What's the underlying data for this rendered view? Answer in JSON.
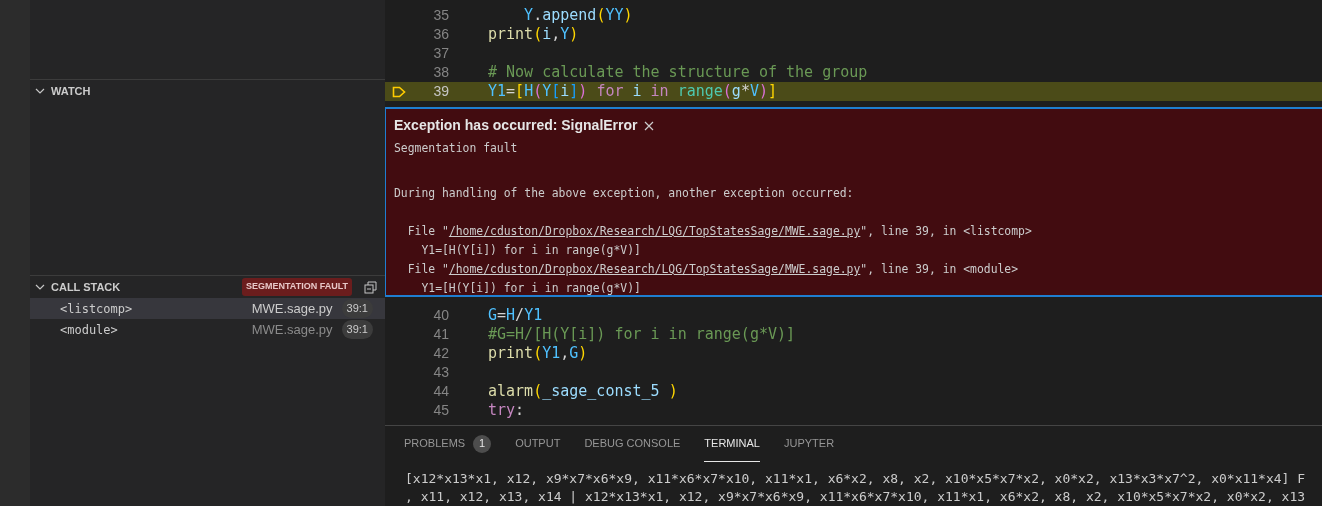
{
  "sidebar": {
    "sections": [
      {
        "title": "WATCH",
        "expanded": true
      },
      {
        "title": "CALL STACK",
        "expanded": true,
        "badge": "SEGMENTATION FAULT",
        "frames": [
          {
            "name": "<listcomp>",
            "file": "MWE.sage.py",
            "position": "39:1",
            "selected": true
          },
          {
            "name": "<module>",
            "file": "MWE.sage.py",
            "position": "39:1",
            "selected": false
          }
        ]
      }
    ]
  },
  "editor": {
    "lines_before": [
      {
        "number": "35",
        "current": false,
        "tokens": [
          {
            "text": "    Y",
            "kind": "const"
          },
          {
            "text": ".",
            "kind": "plain"
          },
          {
            "text": "append",
            "kind": "var"
          },
          {
            "text": "(",
            "kind": "b1"
          },
          {
            "text": "YY",
            "kind": "const"
          },
          {
            "text": ")",
            "kind": "b1"
          }
        ]
      },
      {
        "number": "36",
        "current": false,
        "tokens": [
          {
            "text": "print",
            "kind": "func"
          },
          {
            "text": "(",
            "kind": "b1"
          },
          {
            "text": "i",
            "kind": "var"
          },
          {
            "text": ",",
            "kind": "plain"
          },
          {
            "text": "Y",
            "kind": "const"
          },
          {
            "text": ")",
            "kind": "b1"
          }
        ]
      },
      {
        "number": "37",
        "current": false
      },
      {
        "number": "38",
        "current": false,
        "tokens": [
          {
            "text": "# Now calculate the structure of the group",
            "kind": "comment"
          }
        ]
      },
      {
        "number": "39",
        "current": true,
        "tokens": [
          {
            "text": "Y1",
            "kind": "const"
          },
          {
            "text": "=",
            "kind": "plain"
          },
          {
            "text": "[",
            "kind": "b1"
          },
          {
            "text": "H",
            "kind": "const"
          },
          {
            "text": "(",
            "kind": "b2"
          },
          {
            "text": "Y",
            "kind": "const"
          },
          {
            "text": "[",
            "kind": "b3"
          },
          {
            "text": "i",
            "kind": "var"
          },
          {
            "text": "]",
            "kind": "b3"
          },
          {
            "text": ") ",
            "kind": "b2"
          },
          {
            "text": "for",
            "kind": "kw"
          },
          {
            "text": " i ",
            "kind": "var"
          },
          {
            "text": "in ",
            "kind": "kw"
          },
          {
            "text": "range",
            "kind": "builtin"
          },
          {
            "text": "(",
            "kind": "b2"
          },
          {
            "text": "g",
            "kind": "var"
          },
          {
            "text": "*",
            "kind": "plain"
          },
          {
            "text": "V",
            "kind": "const"
          },
          {
            "text": ")",
            "kind": "b2"
          },
          {
            "text": "]",
            "kind": "b1"
          }
        ]
      }
    ],
    "exception": {
      "title": "Exception has occurred: SignalError",
      "message": "Segmentation fault",
      "note": "During handling of the above exception, another exception occurred:",
      "frames": [
        {
          "prefix": "  File \"",
          "path": "/home/cduston/Dropbox/Research/LQG/TopStatesSage/MWE.sage.py",
          "suffix": "\", line 39, in <listcomp>",
          "code": "    Y1=[H(Y[i]) for i in range(g*V)]"
        },
        {
          "prefix": "  File \"",
          "path": "/home/cduston/Dropbox/Research/LQG/TopStatesSage/MWE.sage.py",
          "suffix": "\", line 39, in <module>",
          "code": "    Y1=[H(Y[i]) for i in range(g*V)]"
        }
      ]
    },
    "lines_after": [
      {
        "number": "40",
        "current": false,
        "tokens": [
          {
            "text": "G",
            "kind": "const"
          },
          {
            "text": "=",
            "kind": "plain"
          },
          {
            "text": "H",
            "kind": "const"
          },
          {
            "text": "/",
            "kind": "plain"
          },
          {
            "text": "Y1",
            "kind": "const"
          }
        ]
      },
      {
        "number": "41",
        "current": false,
        "tokens": [
          {
            "text": "#G=H/[H(Y[i]) for i in range(g*V)]",
            "kind": "comment"
          }
        ]
      },
      {
        "number": "42",
        "current": false,
        "tokens": [
          {
            "text": "print",
            "kind": "func"
          },
          {
            "text": "(",
            "kind": "b1"
          },
          {
            "text": "Y1",
            "kind": "const"
          },
          {
            "text": ",",
            "kind": "plain"
          },
          {
            "text": "G",
            "kind": "const"
          },
          {
            "text": ")",
            "kind": "b1"
          }
        ]
      },
      {
        "number": "43",
        "current": false
      },
      {
        "number": "44",
        "current": false,
        "tokens": [
          {
            "text": "alarm",
            "kind": "func"
          },
          {
            "text": "(",
            "kind": "b1"
          },
          {
            "text": "_sage_const_5 ",
            "kind": "var"
          },
          {
            "text": ")",
            "kind": "b1"
          }
        ]
      },
      {
        "number": "45",
        "current": false,
        "tokens": [
          {
            "text": "try",
            "kind": "kw"
          },
          {
            "text": ":",
            "kind": "plain"
          }
        ]
      }
    ]
  },
  "panel": {
    "tabs": [
      {
        "label": "PROBLEMS",
        "count": "1",
        "selected": false
      },
      {
        "label": "OUTPUT",
        "selected": false
      },
      {
        "label": "DEBUG CONSOLE",
        "selected": false
      },
      {
        "label": "TERMINAL",
        "selected": true
      },
      {
        "label": "JUPYTER",
        "selected": false
      }
    ],
    "terminal_lines": [
      "[x12*x13*x1, x12, x9*x7*x6*x9, x11*x6*x7*x10, x11*x1, x6*x2, x8, x2, x10*x5*x7*x2, x0*x2, x13*x3*x7^2, x0*x11*x4] F",
      ", x11, x12, x13, x14 | x12*x13*x1, x12, x9*x7*x6*x9, x11*x6*x7*x10, x11*x1, x6*x2, x8, x2, x10*x5*x7*x2, x0*x2, x13"
    ]
  }
}
